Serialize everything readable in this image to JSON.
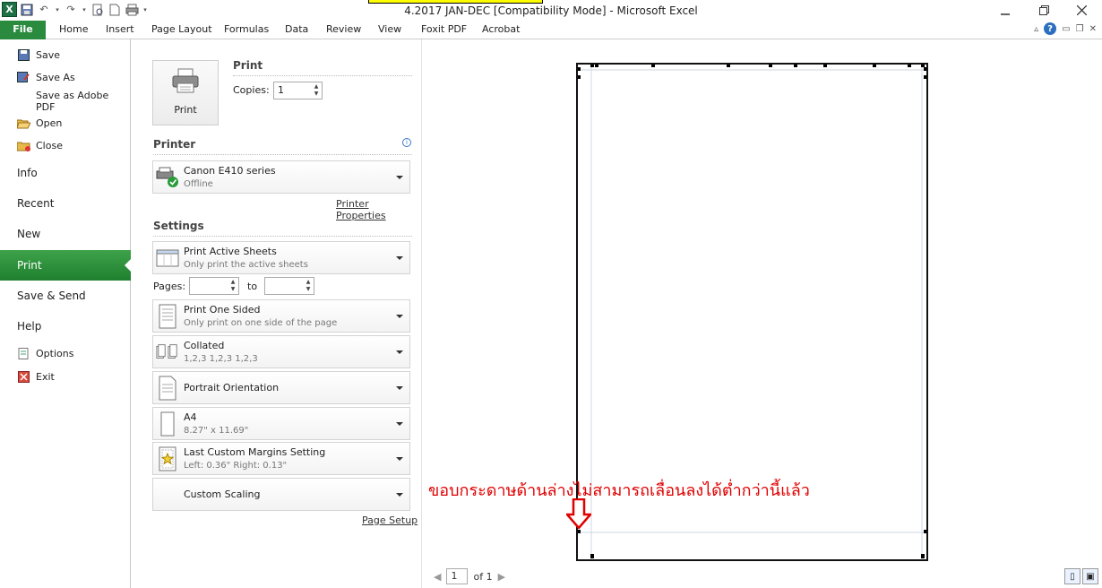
{
  "window": {
    "title": "4.2017 JAN-DEC  [Compatibility Mode]  -  Microsoft Excel",
    "app_icon": "X",
    "minimize_icon": "minimize-icon",
    "restore_icon": "restore-icon",
    "close_icon": "close-icon"
  },
  "ribbon": {
    "tabs": [
      "File",
      "Home",
      "Insert",
      "Page Layout",
      "Formulas",
      "Data",
      "Review",
      "View",
      "Foxit PDF",
      "Acrobat"
    ]
  },
  "nav": {
    "save": "Save",
    "save_as": "Save As",
    "save_as_pdf": "Save as Adobe PDF",
    "open": "Open",
    "close": "Close",
    "info": "Info",
    "recent": "Recent",
    "new": "New",
    "print": "Print",
    "save_send": "Save & Send",
    "help": "Help",
    "options": "Options",
    "exit": "Exit"
  },
  "print_panel": {
    "heading": "Print",
    "print_button": "Print",
    "copies_label": "Copies:",
    "copies_value": "1",
    "printer_heading": "Printer",
    "printer_name": "Canon E410 series",
    "printer_status": "Offline",
    "printer_properties": "Printer Properties",
    "settings_heading": "Settings",
    "pages_label": "Pages:",
    "to_label": "to",
    "page_setup": "Page Setup",
    "settings": [
      {
        "title": "Print Active Sheets",
        "subtitle": "Only print the active sheets"
      },
      {
        "title": "Print One Sided",
        "subtitle": "Only print on one side of the page"
      },
      {
        "title": "Collated",
        "subtitle": "1,2,3    1,2,3    1,2,3"
      },
      {
        "title": "Portrait Orientation",
        "subtitle": ""
      },
      {
        "title": "A4",
        "subtitle": "8.27\" x 11.69\""
      },
      {
        "title": "Last Custom Margins Setting",
        "subtitle": "Left:  0.36\"    Right:  0.13\""
      },
      {
        "title": "Custom Scaling",
        "subtitle": ""
      }
    ]
  },
  "preview": {
    "annotation": "ขอบกระดาษด้านล่างไม่สามารถเลื่อนลงได้ต่ำกว่านี้แล้ว",
    "annotation_color": "#e00000",
    "page_current": "1",
    "page_of": "of 1"
  },
  "colors": {
    "file_tab": "#2a8a3e",
    "nav_active": "#2a8a3e"
  }
}
